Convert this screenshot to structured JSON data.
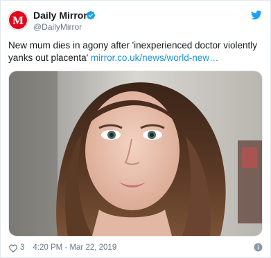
{
  "tweet": {
    "author": {
      "name": "Daily Mirror",
      "handle": "@DailyMirror",
      "avatar_icon": "daily-mirror-logo-icon",
      "avatar_letter": "M",
      "brand_color": "#e4061b"
    },
    "verified_icon": "verified-badge-icon",
    "platform_icon": "twitter-bird-icon",
    "accent_color": "#1b95e0",
    "text": "New mum dies in agony after 'inexperienced doctor violently yanks out placenta'",
    "link": "mirror.co.uk/news/world-new…",
    "likes": "3",
    "timestamp": "4:20 PM - Mar 22, 2019",
    "heart_icon": "heart-outline-icon",
    "info_icon": "info-circle-icon"
  }
}
